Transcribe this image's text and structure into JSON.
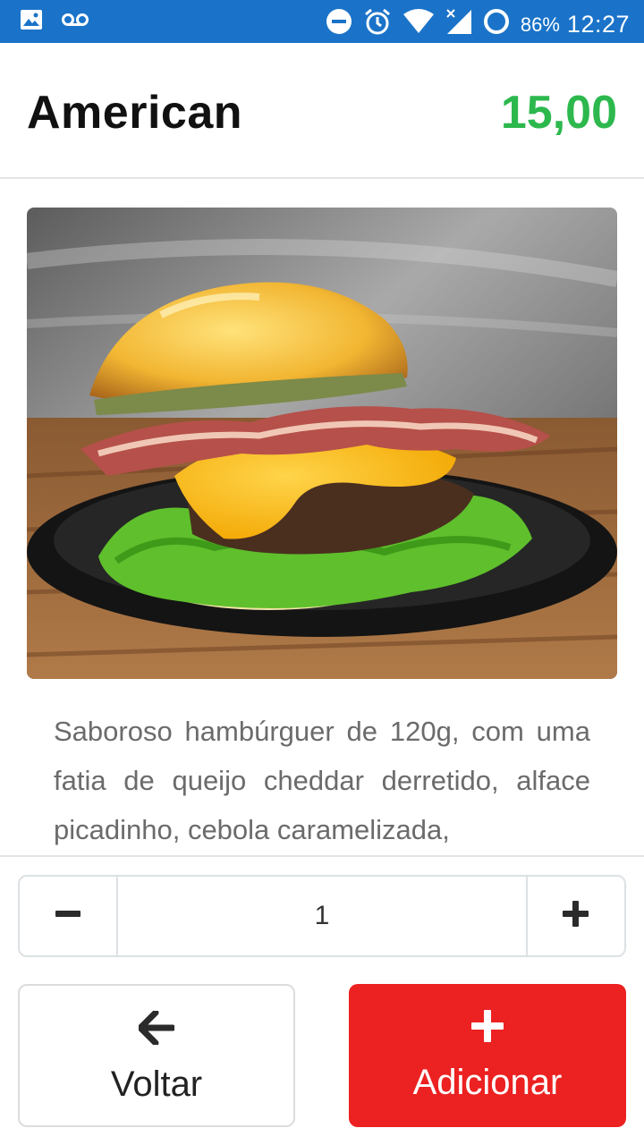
{
  "status_bar": {
    "battery": "86%",
    "time": "12:27",
    "icons": [
      "image-icon",
      "voicemail-icon",
      "do-not-disturb-icon",
      "alarm-icon",
      "wifi-icon",
      "signal-icon",
      "battery-icon"
    ]
  },
  "product": {
    "title": "American",
    "price": "15,00",
    "image": "burger-photo",
    "description": "Saboroso hambúrguer de 120g, com uma fatia de queijo cheddar derretido, alface picadinho, cebola caramelizada,"
  },
  "quantity": {
    "value": "1",
    "decrement_icon": "minus-icon",
    "increment_icon": "plus-icon"
  },
  "actions": {
    "back_label": "Voltar",
    "back_icon": "arrow-left-icon",
    "add_label": "Adicionar",
    "add_icon": "plus-icon"
  },
  "colors": {
    "status_bar": "#1a73c8",
    "price": "#2db84e",
    "add_button": "#ec2121"
  }
}
